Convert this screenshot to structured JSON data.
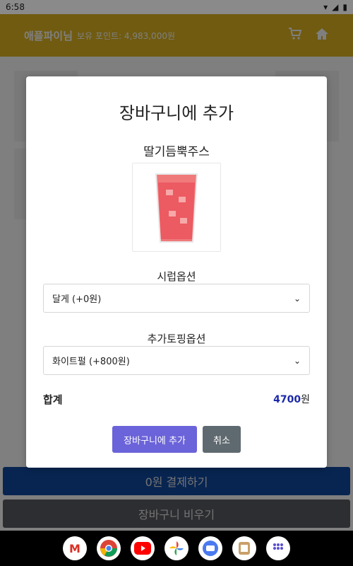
{
  "status": {
    "time": "6:58"
  },
  "appbar": {
    "title": "애플파이님",
    "points": "보유 포인트: 4,983,000원"
  },
  "bottom": {
    "pay_label": "0원 결제하기",
    "clear_label": "장바구니 비우기"
  },
  "modal": {
    "title": "장바구니에 추가",
    "product_name": "딸기듬뿍주스",
    "syrup_label": "시럽옵션",
    "syrup_value": "달게 (+0원)",
    "topping_label": "추가토핑옵션",
    "topping_value": "화이트펄 (+800원)",
    "total_label": "합계",
    "total_amount": "4700",
    "total_unit": "원",
    "add_button": "장바구니에 추가",
    "cancel_button": "취소"
  },
  "colors": {
    "appbar": "#e0b720",
    "primary": "#114aa3",
    "accent": "#6b63d9",
    "total": "#1c2aa8"
  }
}
